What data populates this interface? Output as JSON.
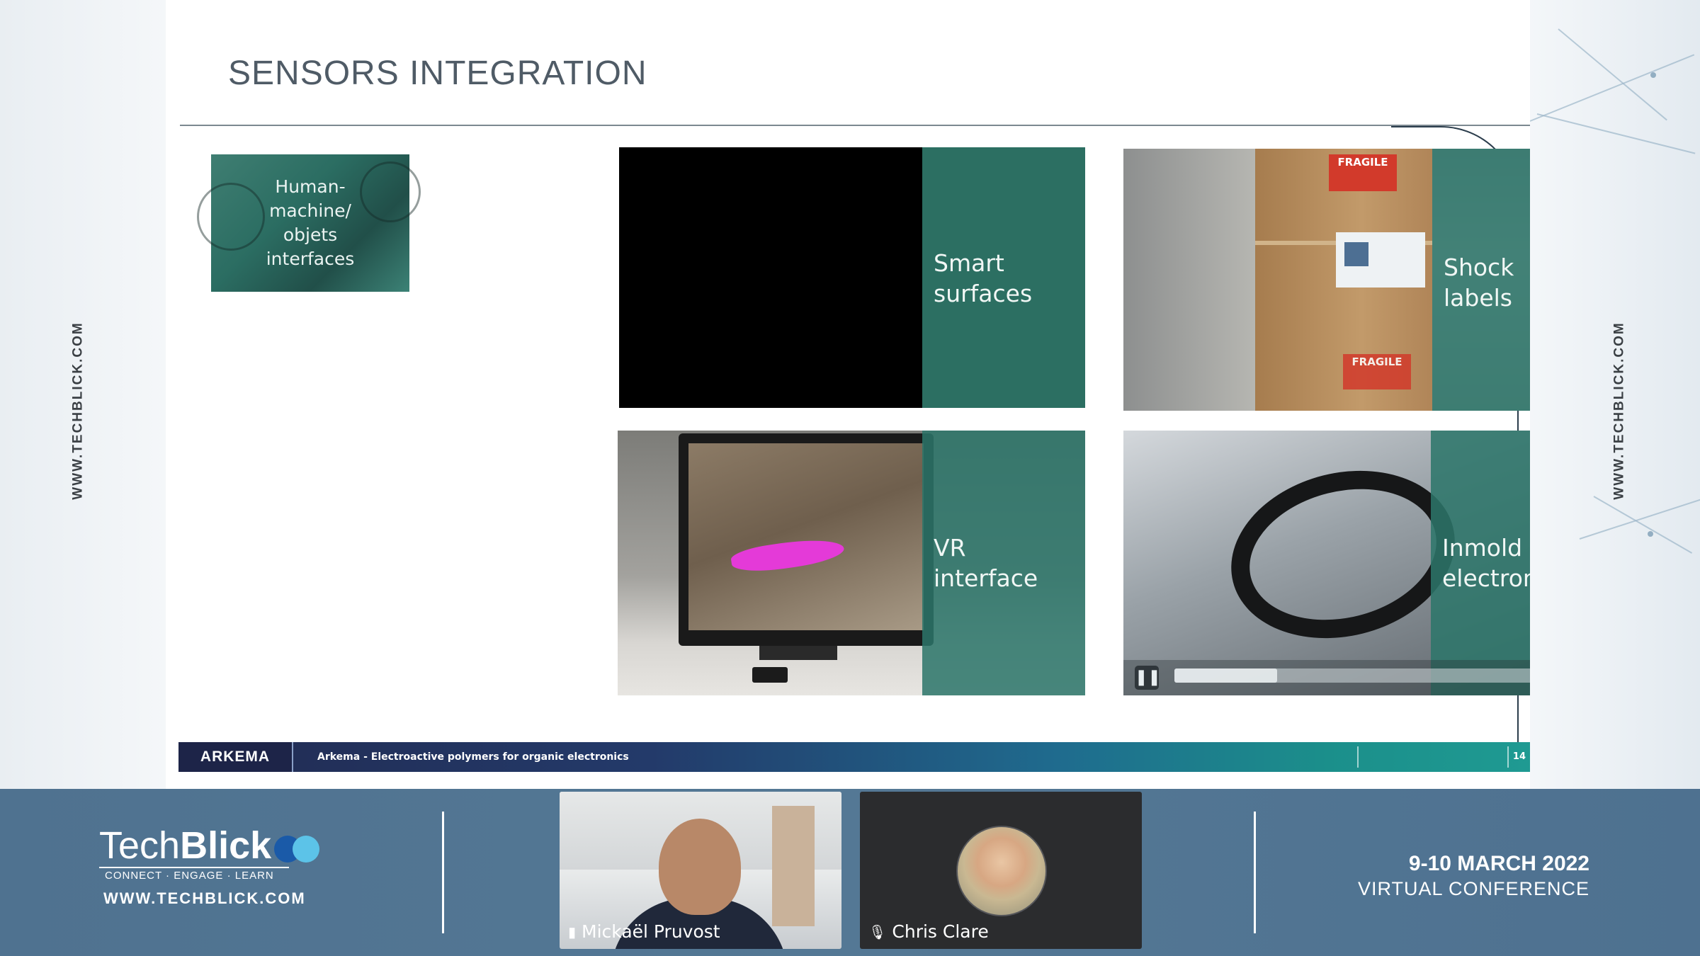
{
  "side_url": "WWW.TECHBLICK.COM",
  "slide": {
    "title": "SENSORS INTEGRATION",
    "hmi_label": "Human-machine/ objets interfaces",
    "tiles": [
      {
        "label": "Smart surfaces"
      },
      {
        "label": "Shock labels"
      },
      {
        "label": "VR interface"
      },
      {
        "label": "Inmold electronics"
      }
    ],
    "stamps": [
      "FRAGILE",
      "FRAGILE"
    ],
    "footer_logo": "ARKEMA",
    "footer_text": "Arkema - Electroactive polymers for organic electronics",
    "page_number": "14"
  },
  "video_player": {
    "pause_icon": "pause-icon",
    "progress_fraction": 0.27,
    "volume_icon": "volume-icon"
  },
  "conference": {
    "brand_prefix": "Tech",
    "brand_suffix": "Blick",
    "tagline": "CONNECT · ENGAGE · LEARN",
    "url": "WWW.TECHBLICK.COM",
    "date": "9-10 MARCH 2022",
    "type": "VIRTUAL CONFERENCE",
    "brand_colors": [
      "#1a5aa8",
      "#5cc3e8"
    ]
  },
  "participants": [
    {
      "name": "Mickaël Pruvost",
      "status_icon": "chat-icon"
    },
    {
      "name": "Chris Clare",
      "status_icon": "mic-muted-icon"
    }
  ]
}
